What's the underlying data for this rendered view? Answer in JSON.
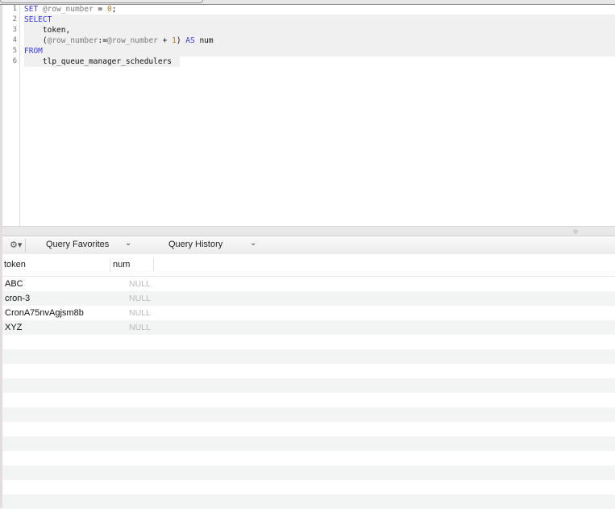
{
  "editor": {
    "line_numbers": [
      "1",
      "2",
      "3",
      "4",
      "5",
      "6"
    ],
    "lines": [
      [
        {
          "t": "SET",
          "c": "kw"
        },
        {
          "t": " "
        },
        {
          "t": "@row_number",
          "c": "var"
        },
        {
          "t": " = "
        },
        {
          "t": "0",
          "c": "num"
        },
        {
          "t": ";"
        }
      ],
      [
        {
          "t": "SELECT",
          "c": "kw"
        }
      ],
      [
        {
          "t": "    token,"
        }
      ],
      [
        {
          "t": "    ("
        },
        {
          "t": "@row_number",
          "c": "var"
        },
        {
          "t": ":="
        },
        {
          "t": "@row_number",
          "c": "var"
        },
        {
          "t": " + "
        },
        {
          "t": "1",
          "c": "num"
        },
        {
          "t": ") "
        },
        {
          "t": "AS",
          "c": "kw"
        },
        {
          "t": " num"
        }
      ],
      [
        {
          "t": "FROM",
          "c": "kw"
        }
      ],
      [
        {
          "t": "    tlp_queue_manager_schedulers"
        }
      ]
    ]
  },
  "toolbar": {
    "gear_icon": "⚙▾",
    "favorites_label": "Query Favorites",
    "history_label": "Query History",
    "chevron": "⌄"
  },
  "results": {
    "columns": [
      "token",
      "num"
    ],
    "rows": [
      [
        "ABC",
        "NULL"
      ],
      [
        "cron-3",
        "NULL"
      ],
      [
        "CronA75nvAgjsm8b",
        "NULL"
      ],
      [
        "XYZ",
        "NULL"
      ]
    ]
  }
}
